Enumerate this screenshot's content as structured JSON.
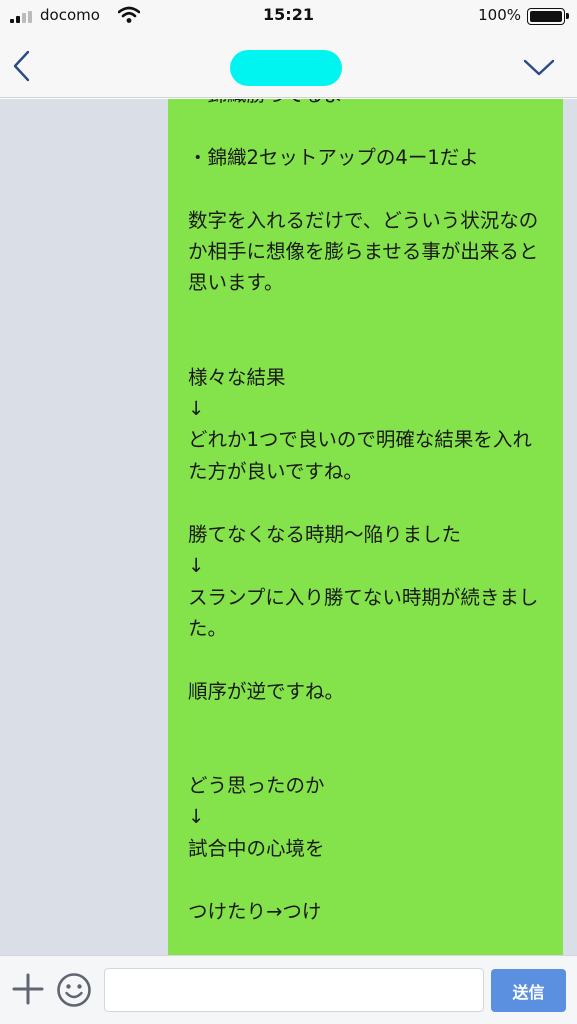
{
  "status_bar": {
    "carrier": "docomo",
    "time": "15:21",
    "battery_percent": "100%"
  },
  "nav": {
    "contact_name": "",
    "colors": {
      "name_redaction": "#00f5f0"
    }
  },
  "chat": {
    "message": "・錦織勝ってるよ\n\n・錦織2セットアップの4ー1だよ\n\n数字を入れるだけで、どういう状況なのか相手に想像を膨らませる事が出来ると思います。\n\n\n様々な結果\n↓\nどれか1つで良いので明確な結果を入れた方が良いですね。\n\n勝てなくなる時期〜陥りました\n↓\nスランプに入り勝てない時期が続きました。\n\n順序が逆ですね。\n\n\nどう思ったのか\n↓\n試合中の心境を\n\nつけたり→つけ",
    "colors": {
      "bubble": "#84e24a",
      "background": "#d9dee7"
    }
  },
  "input_bar": {
    "input_value": "",
    "send_label": "送信",
    "colors": {
      "send_button": "#5b8fe0"
    }
  },
  "icons": [
    "signal-icon",
    "wifi-icon",
    "battery-icon",
    "back-icon",
    "dropdown-icon",
    "add-icon",
    "emoji-icon"
  ]
}
